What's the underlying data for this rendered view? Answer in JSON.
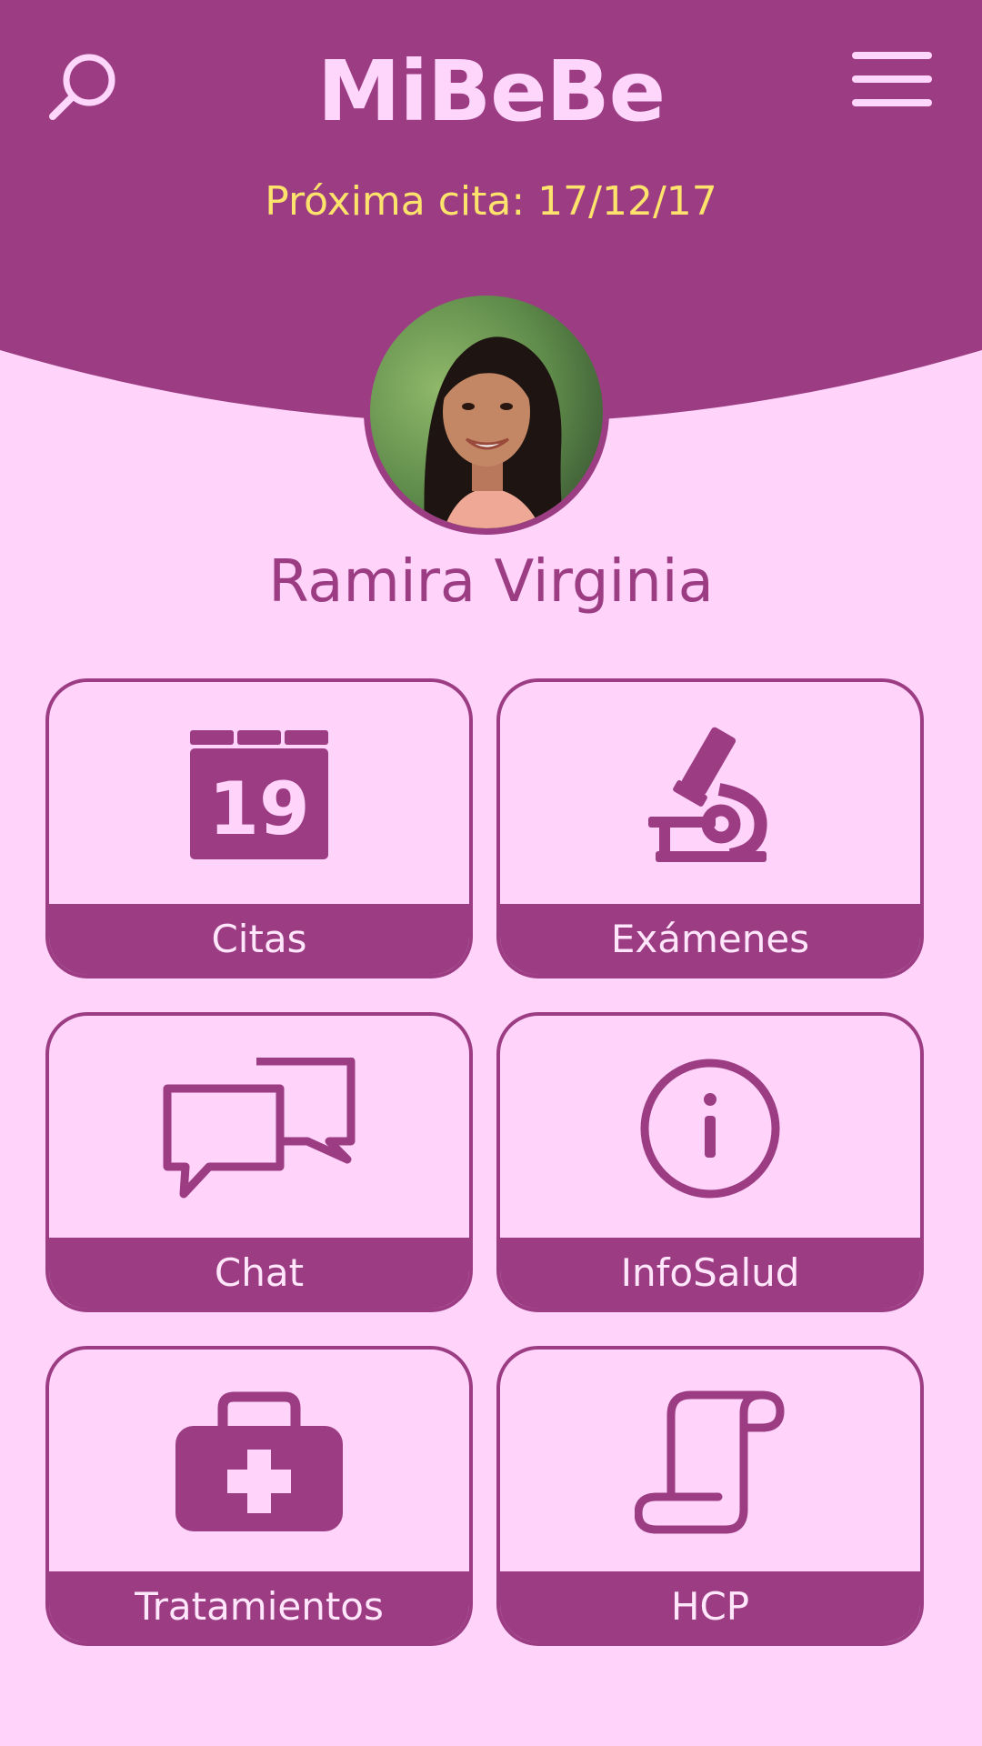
{
  "app": {
    "title": "MiBeBe",
    "next_appointment": "Próxima cita: 17/12/17"
  },
  "user": {
    "name": "Ramira Virginia"
  },
  "tiles": [
    {
      "label": "Citas",
      "icon": "calendar-icon",
      "calendar_day": "19"
    },
    {
      "label": "Exámenes",
      "icon": "microscope-icon"
    },
    {
      "label": "Chat",
      "icon": "chat-bubbles-icon"
    },
    {
      "label": "InfoSalud",
      "icon": "info-icon"
    },
    {
      "label": "Tratamientos",
      "icon": "first-aid-kit-icon"
    },
    {
      "label": "HCP",
      "icon": "scroll-icon"
    }
  ],
  "colors": {
    "primary": "#9c3d84",
    "background": "#ffd3fa",
    "accent_text": "#fde36b",
    "title_text": "#ffd6fb"
  }
}
